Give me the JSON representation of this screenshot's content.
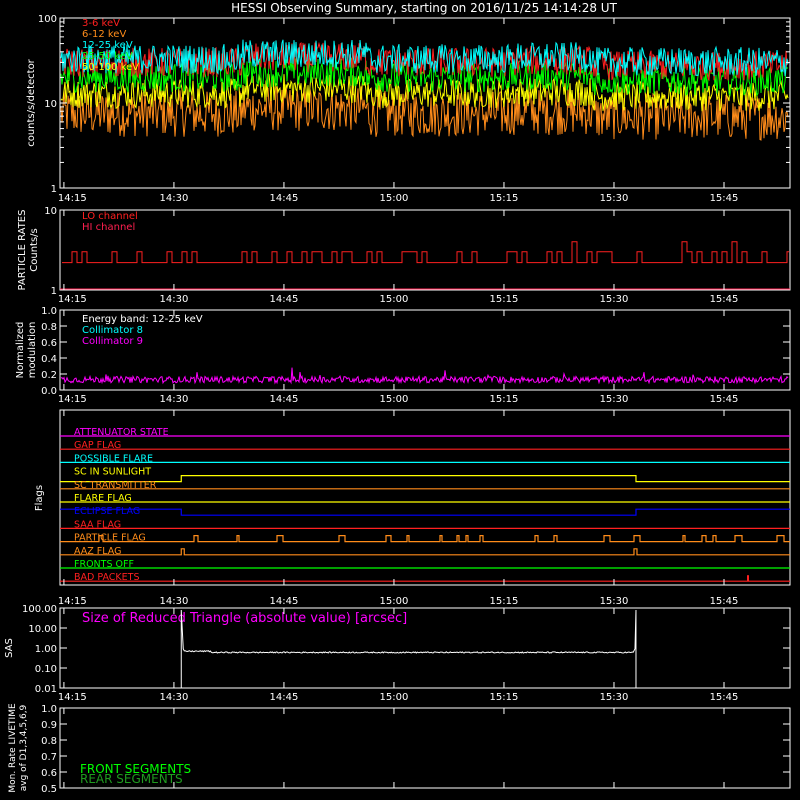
{
  "title": "HESSI Observing Summary, starting on 2016/11/25 14:14:28 UT",
  "x_ticks": [
    "14:15",
    "14:30",
    "14:45",
    "15:00",
    "15:15",
    "15:30",
    "15:45"
  ],
  "colors": {
    "red": "#ff2020",
    "orange": "#ff8c1a",
    "yellow": "#ffff00",
    "green": "#00ff00",
    "cyan": "#00ffff",
    "magenta": "#ff00ff",
    "blue": "#0000ff",
    "white": "#ffffff"
  },
  "chart_data": [
    {
      "type": "line",
      "panel": "count-rates",
      "ylabel": "counts/s/detector",
      "yscale": "log",
      "ylim": [
        1,
        100
      ],
      "yticks": [
        "1",
        "10",
        "100"
      ],
      "x_range": [
        "14:14:28",
        "15:54:00"
      ],
      "series": [
        {
          "name": "3-6 keV",
          "color": "red",
          "level": 30
        },
        {
          "name": "6-12 keV",
          "color": "orange",
          "level": 7.5
        },
        {
          "name": "12-25 keV",
          "color": "cyan",
          "level": 33
        },
        {
          "name": "25-50 keV",
          "color": "green",
          "level": 20
        },
        {
          "name": "50-100 keV",
          "color": "yellow",
          "level": 13
        }
      ]
    },
    {
      "type": "line",
      "panel": "particle-rates",
      "ylabel": "PARTICLE RATES Counts/s",
      "yscale": "log",
      "ylim": [
        1,
        10
      ],
      "yticks": [
        "1",
        "10"
      ],
      "series": [
        {
          "name": "LO channel",
          "color": "red",
          "base": 2.2,
          "high": 3.0
        },
        {
          "name": "HI channel",
          "color": "red",
          "base": 1.0
        }
      ]
    },
    {
      "type": "line",
      "panel": "modulation",
      "ylabel": "Normalized modulation",
      "ylim": [
        0,
        1
      ],
      "yticks": [
        "0.0",
        "0.2",
        "0.4",
        "0.6",
        "0.8",
        "1.0"
      ],
      "annotation": "Energy band: 12-25 keV",
      "series": [
        {
          "name": "Collimator 8",
          "color": "cyan",
          "level": 0.12
        },
        {
          "name": "Collimator 9",
          "color": "magenta",
          "level": 0.12
        }
      ]
    },
    {
      "type": "line",
      "panel": "flags",
      "ylabel": "Flags",
      "series": [
        {
          "name": "ATTENUATOR STATE",
          "color": "magenta"
        },
        {
          "name": "GAP FLAG",
          "color": "red"
        },
        {
          "name": "POSSIBLE FLARE",
          "color": "cyan"
        },
        {
          "name": "SC IN SUNLIGHT",
          "color": "yellow"
        },
        {
          "name": "SC TRANSMITTER",
          "color": "orange"
        },
        {
          "name": "FLARE FLAG",
          "color": "yellow"
        },
        {
          "name": "ECLIPSE FLAG",
          "color": "blue"
        },
        {
          "name": "SAA FLAG",
          "color": "red"
        },
        {
          "name": "PARTICLE FLAG",
          "color": "orange"
        },
        {
          "name": "AAZ FLAG",
          "color": "orange"
        },
        {
          "name": "FRONTS OFF",
          "color": "green"
        },
        {
          "name": "BAD PACKETS",
          "color": "red"
        }
      ]
    },
    {
      "type": "line",
      "panel": "sas",
      "ylabel": "SAS",
      "yscale": "log",
      "ylim": [
        0.01,
        100
      ],
      "yticks": [
        "0.01",
        "0.10",
        "1.00",
        "10.00",
        "100.00"
      ],
      "annotation": "Size of Reduced Triangle (absolute value) [arcsec]",
      "series": [
        {
          "name": "Size of Reduced Triangle",
          "color": "white",
          "start": "14:31",
          "end": "15:33",
          "level": 0.6
        }
      ]
    },
    {
      "type": "line",
      "panel": "livetime",
      "ylabel": "Mon. Rate LIVETIME avg of D1,3,4,5,6,9",
      "ylim": [
        0.5,
        1.0
      ],
      "yticks": [
        "0.5",
        "0.6",
        "0.7",
        "0.8",
        "0.9",
        "1.0"
      ],
      "series": [
        {
          "name": "FRONT SEGMENTS",
          "color": "green"
        },
        {
          "name": "REAR SEGMENTS",
          "color": "green"
        }
      ]
    }
  ]
}
